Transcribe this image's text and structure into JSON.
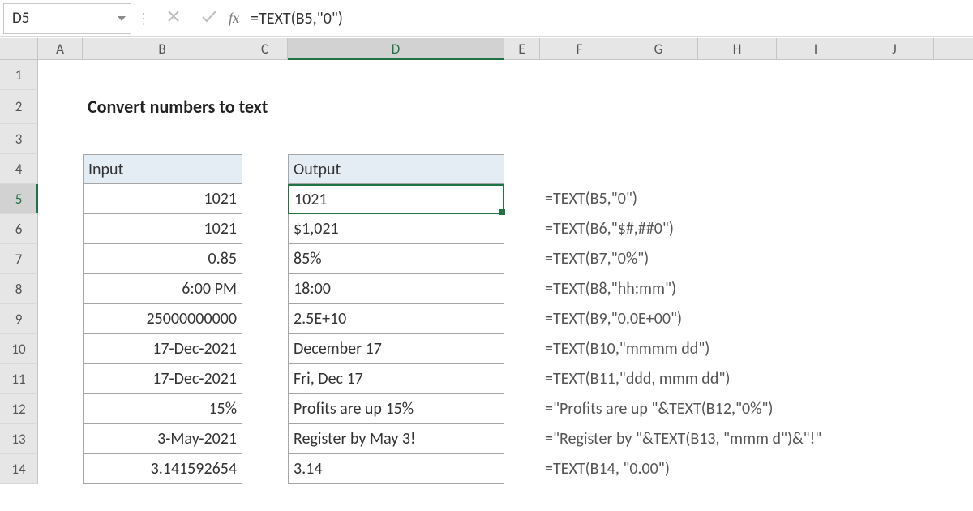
{
  "namebox": {
    "value": "D5"
  },
  "formula_bar": {
    "value": "=TEXT(B5,\"0\")"
  },
  "fx_label": "fx",
  "columns": [
    "A",
    "B",
    "C",
    "D",
    "E",
    "F",
    "G",
    "H",
    "I",
    "J"
  ],
  "active_column": "D",
  "row_numbers": [
    "1",
    "2",
    "3",
    "4",
    "5",
    "6",
    "7",
    "8",
    "9",
    "10",
    "11",
    "12",
    "13",
    "14"
  ],
  "active_row": "5",
  "title": "Convert numbers to text",
  "table_headers": {
    "input": "Input",
    "output": "Output"
  },
  "rows": [
    {
      "input": "1021",
      "output": "1021",
      "formula": "=TEXT(B5,\"0\")"
    },
    {
      "input": "1021",
      "output": "$1,021",
      "formula": "=TEXT(B6,\"$#,##0\")"
    },
    {
      "input": "0.85",
      "output": "85%",
      "formula": "=TEXT(B7,\"0%\")"
    },
    {
      "input": "6:00 PM",
      "output": "18:00",
      "formula": "=TEXT(B8,\"hh:mm\")"
    },
    {
      "input": "25000000000",
      "output": "2.5E+10",
      "formula": "=TEXT(B9,\"0.0E+00\")"
    },
    {
      "input": "17-Dec-2021",
      "output": "December 17",
      "formula": "=TEXT(B10,\"mmmm dd\")"
    },
    {
      "input": "17-Dec-2021",
      "output": "Fri, Dec 17",
      "formula": "=TEXT(B11,\"ddd, mmm dd\")"
    },
    {
      "input": "15%",
      "output": "Profits are up 15%",
      "formula": "=\"Profits are up \"&TEXT(B12,\"0%\")"
    },
    {
      "input": "3-May-2021",
      "output": "Register by May 3!",
      "formula": "=\"Register by \"&TEXT(B13, \"mmm d\")&\"!\""
    },
    {
      "input": "3.141592654",
      "output": "3.14",
      "formula": "=TEXT(B14, \"0.00\")"
    }
  ]
}
